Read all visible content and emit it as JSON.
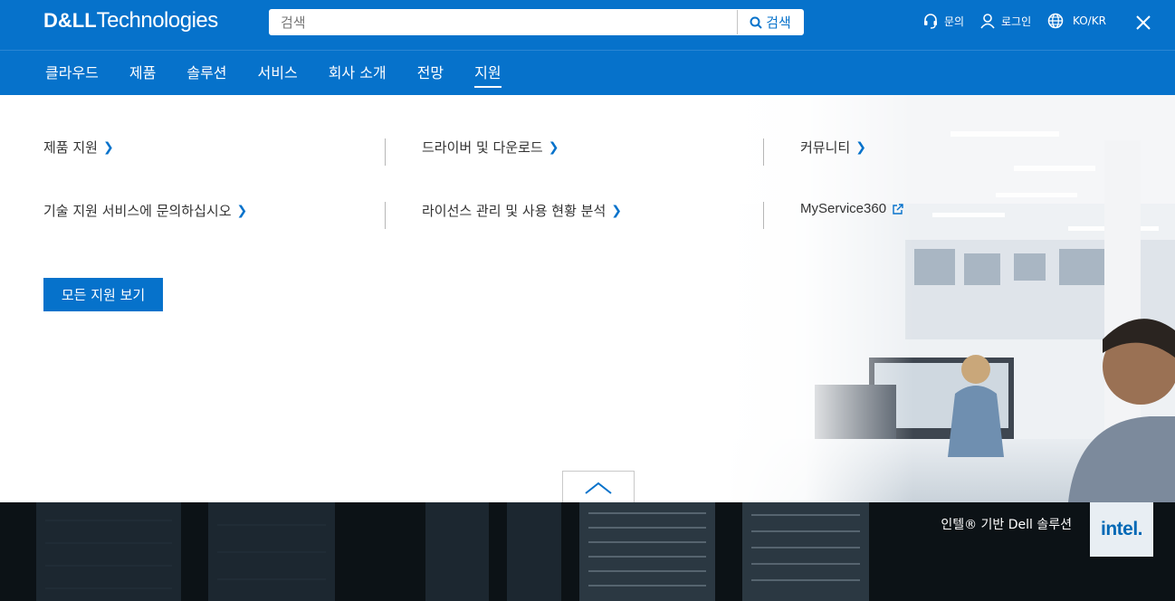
{
  "brand": {
    "dell": "D&LL",
    "tech": "Technologies"
  },
  "search": {
    "placeholder": "검색",
    "button_label": "검색"
  },
  "utility": {
    "contact_label": "문의",
    "login_label": "로그인",
    "locale_label": "KO/KR"
  },
  "nav": {
    "items": [
      {
        "label": "클라우드"
      },
      {
        "label": "제품"
      },
      {
        "label": "솔루션"
      },
      {
        "label": "서비스"
      },
      {
        "label": "회사 소개"
      },
      {
        "label": "전망"
      },
      {
        "label": "지원",
        "active": true
      }
    ]
  },
  "support_menu": {
    "links": [
      {
        "label": "제품 지원"
      },
      {
        "label": "드라이버 및 다운로드"
      },
      {
        "label": "커뮤니티"
      },
      {
        "label": "기술 지원 서비스에 문의하십시오"
      },
      {
        "label": "라이선스 관리 및 사용 현황 분석"
      },
      {
        "label": "MyService360"
      }
    ],
    "all_button_label": "모든 지원 보기"
  },
  "footer": {
    "promo_text": "인텔® 기반 Dell 솔루션",
    "intel_logo": "intel."
  },
  "colors": {
    "brand_blue": "#0672cb",
    "footer_dark": "#0c1216"
  }
}
